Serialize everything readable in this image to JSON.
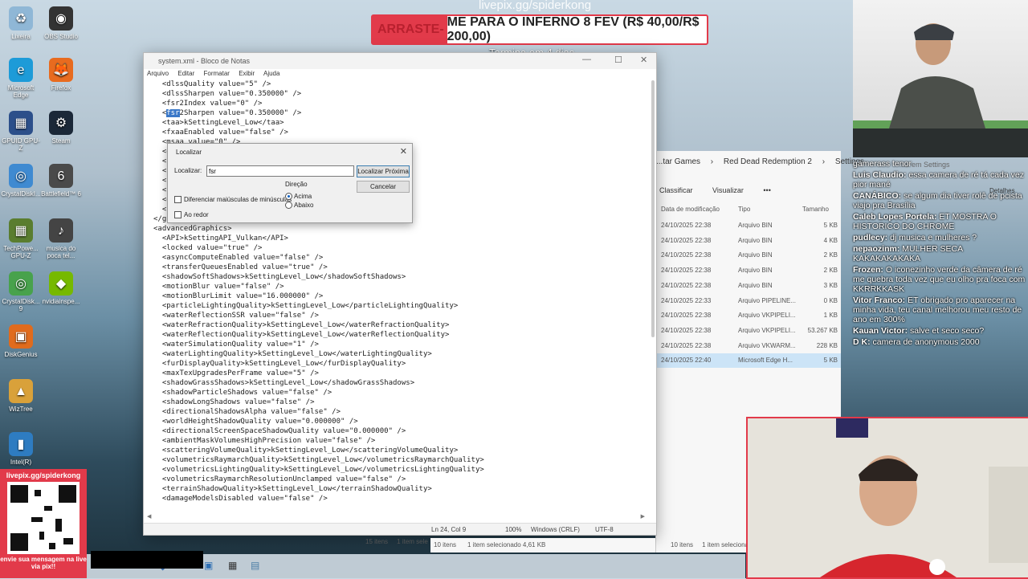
{
  "desktop_icons": [
    {
      "label": "Lixeira",
      "icon": "recycle-bin-icon",
      "glyph": "♻",
      "color": "#8fb7d6"
    },
    {
      "label": "OBS Studio",
      "icon": "obs-icon",
      "glyph": "◉",
      "color": "#333333"
    },
    {
      "label": "Microsoft Edge",
      "icon": "edge-icon",
      "glyph": "e",
      "color": "#1d9bd8"
    },
    {
      "label": "Firefox",
      "icon": "firefox-icon",
      "glyph": "🦊",
      "color": "#e86b1f"
    },
    {
      "label": "GPUID GPU-Z",
      "icon": "gpuz-icon",
      "glyph": "▦",
      "color": "#2c4f8a"
    },
    {
      "label": "Steam",
      "icon": "steam-icon",
      "glyph": "⚙",
      "color": "#1b2838"
    },
    {
      "label": "CrystalDiskI...",
      "icon": "crystaldisk-icon",
      "glyph": "◎",
      "color": "#3f8ad1"
    },
    {
      "label": "Battlefield™ 6",
      "icon": "battlefield-icon",
      "glyph": "6",
      "color": "#4a4a4a"
    },
    {
      "label": "TechPowe... GPU-Z",
      "icon": "techpowerup-icon",
      "glyph": "▦",
      "color": "#5a7d2f"
    },
    {
      "label": "musica do poca tel...",
      "icon": "music-file-icon",
      "glyph": "♪",
      "color": "#444444"
    },
    {
      "label": "CrystalDisk... 9",
      "icon": "crystaldisk-icon",
      "glyph": "◎",
      "color": "#48a24c"
    },
    {
      "label": "nvidiainspe...",
      "icon": "nvidia-icon",
      "glyph": "◆",
      "color": "#76b900"
    },
    {
      "label": "DiskGenius",
      "icon": "diskgenius-icon",
      "glyph": "▣",
      "color": "#e06b1d"
    },
    {
      "label": "WizTree",
      "icon": "wiztree-icon",
      "glyph": "▲",
      "color": "#d9a13a"
    },
    {
      "label": "Intel(R)",
      "icon": "intel-icon",
      "glyph": "▮",
      "color": "#2e7cc1"
    }
  ],
  "stream": {
    "livepix_top": "livepix.gg/spiderkong",
    "donation_red": "ARRASTE-",
    "donation_rest": "ME PARA O INFERNO 8 FEV (R$ 40,00/R$ 200,00)",
    "termina": "Termina em 4 dias",
    "qr_url": "livepix.gg/spiderkong",
    "qr_cta": "envie sua mensagem na live via pix!!"
  },
  "notepad": {
    "title": "system.xml - Bloco de Notas",
    "menu": [
      "Arquivo",
      "Editar",
      "Formatar",
      "Exibir",
      "Ajuda"
    ],
    "lines": [
      "  <dlssQuality value=\"5\" />",
      "  <dlssSharpen value=\"0.350000\" />",
      "  <fsr2Index value=\"0\" />",
      "  <fsr2Sharpen value=\"0.350000\" />",
      "  <taa>kSettingLevel_Low</taa>",
      "  <fxaaEnabled value=\"false\" />",
      "  <msaa value=\"0\" />",
      "  <g",
      "  <h",
      "  <h",
      "  <h",
      "  <h",
      "  <g",
      "  <h",
      "</graphics>",
      "<advancedGraphics>",
      "  <API>kSettingAPI_Vulkan</API>",
      "  <locked value=\"true\" />",
      "  <asyncComputeEnabled value=\"false\" />",
      "  <transferQueuesEnabled value=\"true\" />",
      "  <shadowSoftShadows>kSettingLevel_Low</shadowSoftShadows>",
      "  <motionBlur value=\"false\" />",
      "  <motionBlurLimit value=\"16.000000\" />",
      "  <particleLightingQuality>kSettingLevel_Low</particleLightingQuality>",
      "  <waterReflectionSSR value=\"false\" />",
      "  <waterRefractionQuality>kSettingLevel_Low</waterRefractionQuality>",
      "  <waterReflectionQuality>kSettingLevel_Low</waterReflectionQuality>",
      "  <waterSimulationQuality value=\"1\" />",
      "  <waterLightingQuality>kSettingLevel_Low</waterLightingQuality>",
      "  <furDisplayQuality>kSettingLevel_Low</furDisplayQuality>",
      "  <maxTexUpgradesPerFrame value=\"5\" />",
      "  <shadowGrassShadows>kSettingLevel_Low</shadowGrassShadows>",
      "  <shadowParticleShadows value=\"false\" />",
      "  <shadowLongShadows value=\"false\" />",
      "  <directionalShadowsAlpha value=\"false\" />",
      "  <worldHeightShadowQuality value=\"0.000000\" />",
      "  <directionalScreenSpaceShadowQuality value=\"0.000000\" />",
      "  <ambientMaskVolumesHighPrecision value=\"false\" />",
      "  <scatteringVolumeQuality>kSettingLevel_Low</scatteringVolumeQuality>",
      "  <volumetricsRaymarchQuality>kSettingLevel_Low</volumetricsRaymarchQuality>",
      "  <volumetricsLightingQuality>kSettingLevel_Low</volumetricsLightingQuality>",
      "  <volumetricsRaymarchResolutionUnclamped value=\"false\" />",
      "  <terrainShadowQuality>kSettingLevel_Low</terrainShadowQuality>",
      "  <damageModelsDisabled value=\"false\" />"
    ],
    "highlight_line": 3,
    "highlight_text": "fsr",
    "status": {
      "position": "Ln 24, Col 9",
      "zoom": "100%",
      "eol": "Windows (CRLF)",
      "encoding": "UTF-8"
    }
  },
  "find_dialog": {
    "title": "Localizar",
    "find_label": "Localizar:",
    "find_value": "fsr",
    "find_next": "Localizar Próxima",
    "cancel": "Cancelar",
    "match_case": "Diferenciar maiúsculas de minúsculas",
    "wrap": "Ao redor",
    "direction_label": "Direção",
    "up": "Acima",
    "down": "Abaixo",
    "direction_selected": "up"
  },
  "explorer": {
    "crumbs": [
      "...tar Games",
      "Red Dead Redemption 2",
      "Settings"
    ],
    "search_placeholder": "...r em Settings",
    "sort": "Classificar",
    "view": "Visualizar",
    "more": "•••",
    "details": "Detalhes",
    "headers": [
      "Data de modificação",
      "Tipo",
      "Tamanho"
    ],
    "rows": [
      {
        "date": "24/10/2025 22:38",
        "type": "Arquivo BIN",
        "size": "5 KB"
      },
      {
        "date": "24/10/2025 22:38",
        "type": "Arquivo BIN",
        "size": "4 KB"
      },
      {
        "date": "24/10/2025 22:38",
        "type": "Arquivo BIN",
        "size": "2 KB"
      },
      {
        "date": "24/10/2025 22:38",
        "type": "Arquivo BIN",
        "size": "2 KB"
      },
      {
        "date": "24/10/2025 22:38",
        "type": "Arquivo BIN",
        "size": "3 KB"
      },
      {
        "date": "24/10/2025 22:33",
        "type": "Arquivo PIPELINE...",
        "size": "0 KB"
      },
      {
        "date": "24/10/2025 22:38",
        "type": "Arquivo VKPIPELI...",
        "size": "1 KB"
      },
      {
        "date": "24/10/2025 22:38",
        "type": "Arquivo VKPIPELI...",
        "size": "53.267 KB"
      },
      {
        "date": "24/10/2025 22:38",
        "type": "Arquivo VKWARM...",
        "size": "228 KB"
      },
      {
        "date": "24/10/2025 22:40",
        "type": "Microsoft Edge H...",
        "size": "5 KB"
      }
    ],
    "status_items": "10 itens",
    "status_selected": "1 item selecionado  4,61 KB",
    "back_status_items": "15 itens",
    "back_status_selected": "1 item sele"
  },
  "chat": [
    {
      "user": "",
      "text": "gamerass tenor"
    },
    {
      "user": "Luis Claudio:",
      "text": "essa camera de ré tá cada vez pior mané"
    },
    {
      "user": "CANÁBICO:",
      "text": "se algum dia tiver rolê de pcista viajo pra Brasília"
    },
    {
      "user": "Caleb Lopes Portela:",
      "text": "ET MOSTRA O HISTORICO DO CHROME"
    },
    {
      "user": "pudlecy:",
      "text": "dj musica e mulheres ?"
    },
    {
      "user": "nepaozinm:",
      "text": "MULHER SECA KAKAKAKAKAKA"
    },
    {
      "user": "Frozen:",
      "text": "O iconezinho verde da câmera de ré me quebra toda vez que eu olho pra foca com KKRRKKASK"
    },
    {
      "user": "Vitor Franco:",
      "text": "ET obrigado pro aparecer na minha vida, teu canal melhorou meu resto de ano em 300%"
    },
    {
      "user": "Kauan Victor:",
      "text": "salve et seco seco?"
    },
    {
      "user": "D K:",
      "text": "camera de anonymous 2000"
    }
  ]
}
